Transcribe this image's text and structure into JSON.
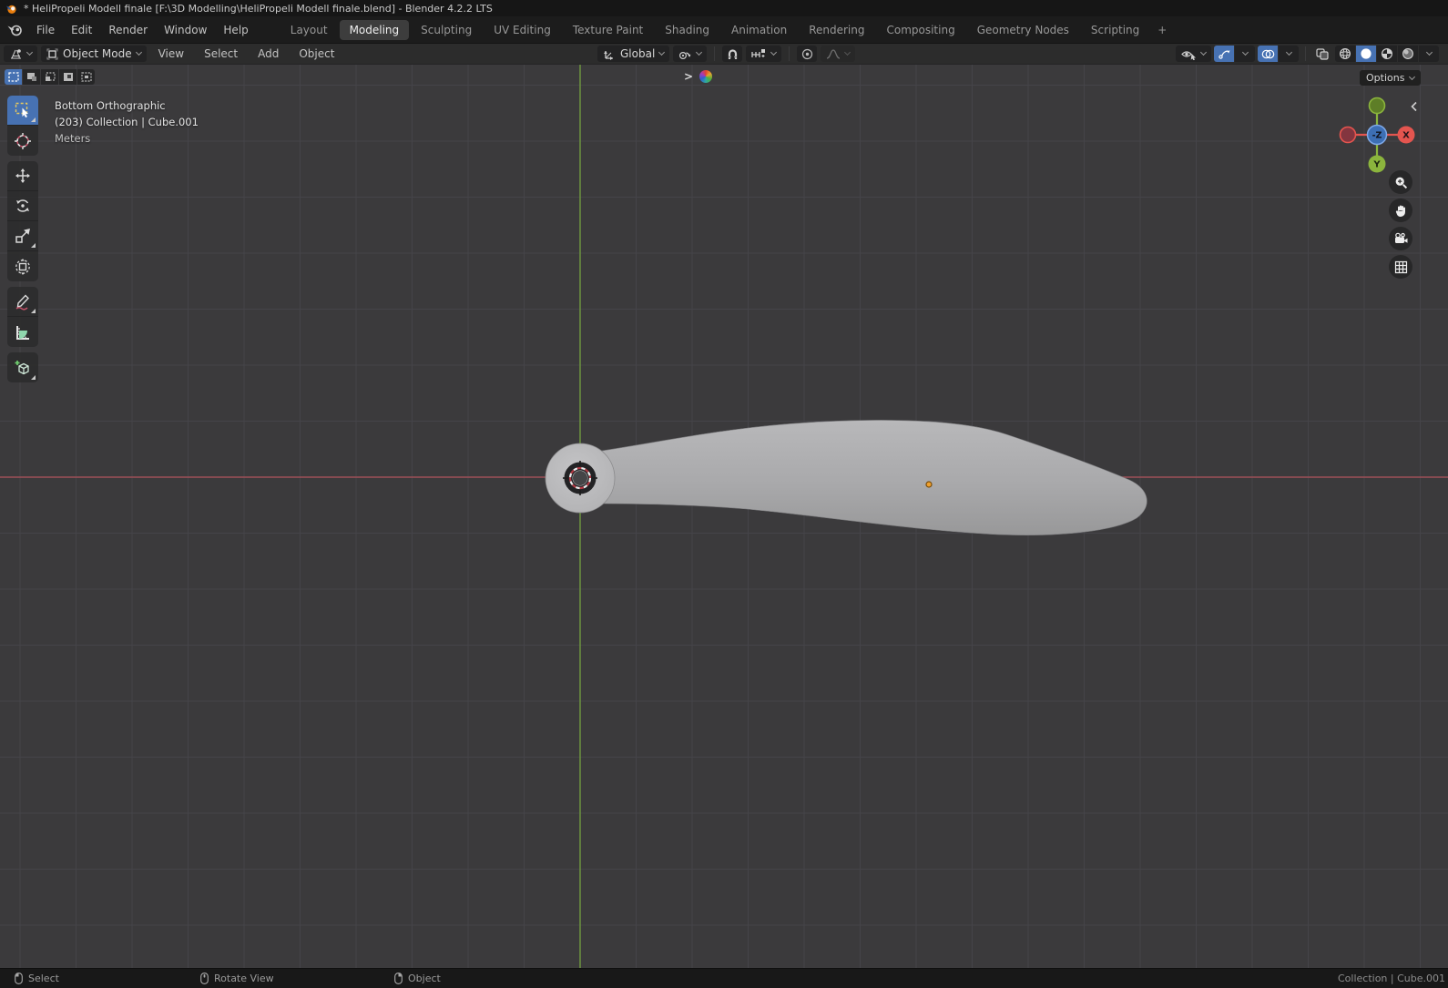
{
  "window": {
    "title": "* HeliPropeli Modell finale [F:\\3D Modelling\\HeliPropeli Modell finale.blend] - Blender 4.2.2 LTS"
  },
  "topbar": {
    "menus": [
      "File",
      "Edit",
      "Render",
      "Window",
      "Help"
    ],
    "tabs": [
      "Layout",
      "Modeling",
      "Sculpting",
      "UV Editing",
      "Texture Paint",
      "Shading",
      "Animation",
      "Rendering",
      "Compositing",
      "Geometry Nodes",
      "Scripting"
    ],
    "active_tab": "Modeling",
    "add_tab": "+"
  },
  "toolheader": {
    "mode_selector": "Object Mode",
    "menus": [
      "View",
      "Select",
      "Add",
      "Object"
    ],
    "orientation": "Global"
  },
  "viewport": {
    "options_button": "Options",
    "info": {
      "view": "Bottom Orthographic",
      "collection": "(203) Collection | Cube.001",
      "units": "Meters"
    },
    "gizmo_labels": {
      "center": "-Z",
      "x": "X",
      "y": "Y"
    }
  },
  "statusbar": {
    "left_mouse": "Select",
    "middle_mouse": "Rotate View",
    "right_mouse": "Object",
    "context": "Collection | Cube.001"
  },
  "icons": {
    "app": "blender-logo-icon",
    "tools": [
      "select-box-icon",
      "cursor-icon",
      "move-icon",
      "rotate-icon",
      "scale-icon",
      "transform-icon",
      "annotate-icon",
      "measure-icon",
      "add-cube-icon"
    ],
    "header": [
      "editor-type-icon",
      "object-mode-icon",
      "orientation-axes-icon",
      "pivot-point-icon",
      "snap-magnet-icon",
      "snap-target-icon",
      "proportional-icon",
      "falloff-curve-icon",
      "visibility-eye-icon",
      "gizmos-icon",
      "overlays-icon",
      "xray-icon",
      "wireframe-shading-icon",
      "solid-shading-icon",
      "material-shading-icon",
      "rendered-shading-icon"
    ],
    "nav": [
      "zoom-icon",
      "pan-hand-icon",
      "camera-icon",
      "grid-ortho-icon"
    ]
  },
  "colors": {
    "accent": "#4772b3",
    "axis-x": "#9e4f58",
    "axis-y": "#6f9a3f",
    "origin": "#efa02e",
    "gizmo-x": "#e4554f",
    "gizmo-x-neg": "#83353f",
    "gizmo-y": "#8bb43d",
    "gizmo-y-neg": "#5e7e27",
    "gizmo-z": "#3d6fb4"
  }
}
